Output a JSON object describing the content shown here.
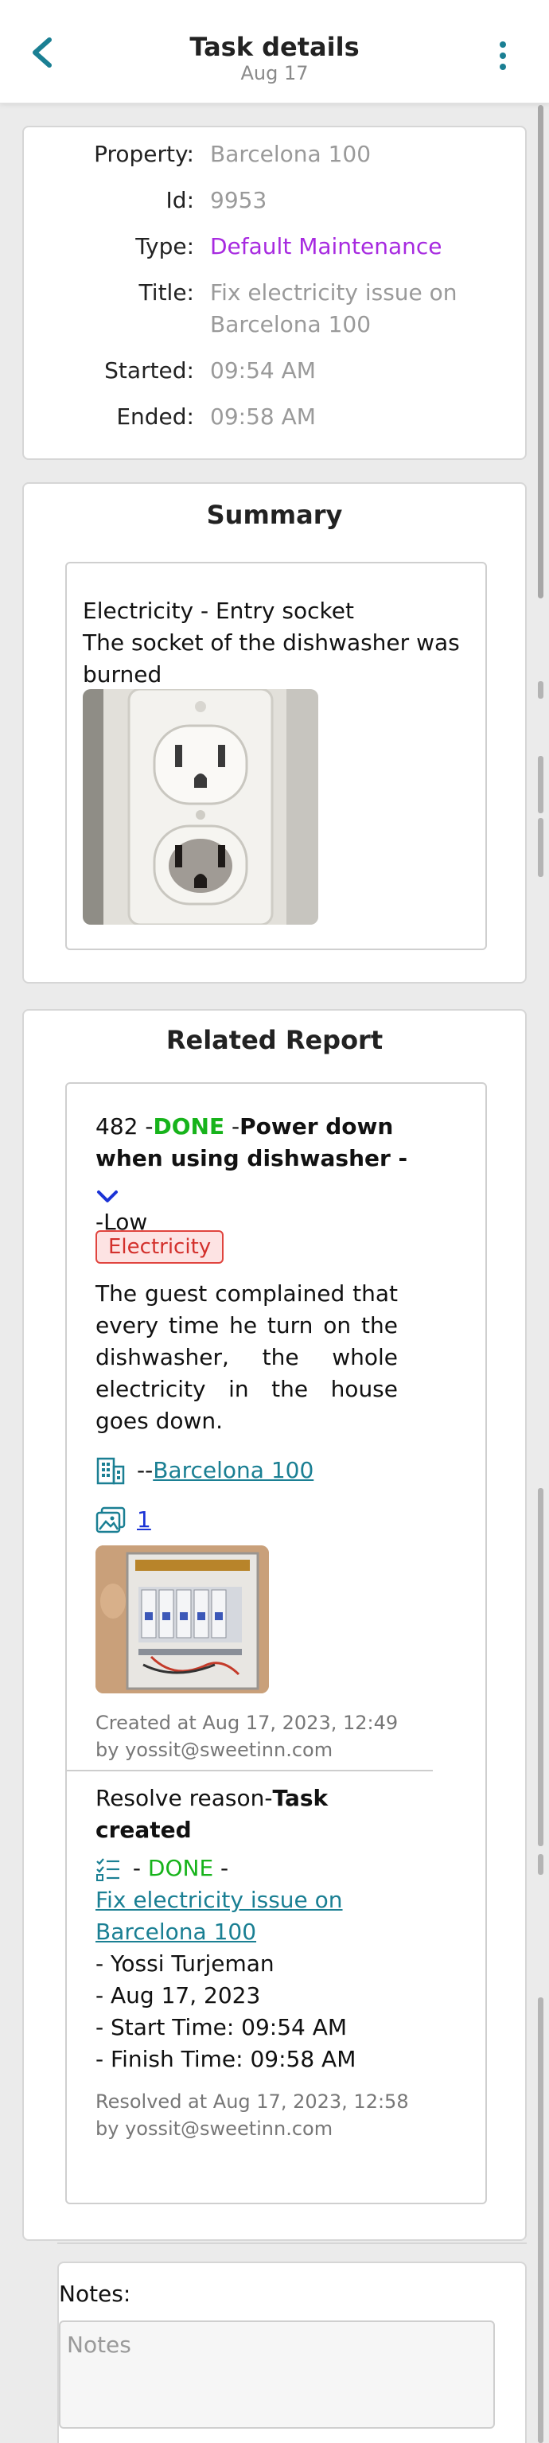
{
  "header": {
    "title": "Task details",
    "subtitle": "Aug 17"
  },
  "details": {
    "rows": [
      {
        "label": "Property:",
        "value": "Barcelona 100"
      },
      {
        "label": "Id:",
        "value": "9953"
      },
      {
        "label": "Type:",
        "value": "Default Maintenance"
      },
      {
        "label": "Title:",
        "value": "Fix electricity issue on Barcelona 100"
      },
      {
        "label": "Started:",
        "value": "09:54 AM"
      },
      {
        "label": "Ended:",
        "value": "09:58 AM"
      }
    ]
  },
  "summary": {
    "heading": "Summary",
    "line1": "Electricity - Entry socket",
    "line2": "The socket of the dishwasher was burned"
  },
  "report": {
    "heading": "Related Report",
    "id": "482",
    "sep1": " -",
    "status": "DONE",
    "sep2": " -",
    "title": "Power down when using dishwasher",
    "sep3": " -",
    "priority": "-Low",
    "tag": "Electricity",
    "description": "The guest complained that every time he turn on the dishwasher, the whole electricity in the house goes down.",
    "property_prefix": "-- ",
    "property_link": "Barcelona 100",
    "images_count": "1",
    "created": "Created at Aug 17, 2023, 12:49",
    "created_by": "by yossit@sweetinn.com",
    "resolve_label": "Resolve reason-",
    "resolve_reason": "Task created",
    "task_prefix": " - ",
    "task_status": "DONE",
    "task_suffix": " -",
    "task_link": "Fix electricity issue on Barcelona 100",
    "assignee": " - Yossi Turjeman",
    "date": " - Aug 17, 2023",
    "start_time": " - Start Time: 09:54 AM",
    "finish_time": " - Finish Time: 09:58 AM",
    "resolved": "Resolved at Aug 17, 2023, 12:58",
    "resolved_by": "by yossit@sweetinn.com"
  },
  "notes": {
    "label": "Notes:",
    "placeholder": "Notes"
  },
  "colors": {
    "accent": "#1a7f93",
    "done": "#17b31b",
    "type": "#a72ae0",
    "tag_border": "#e0443e"
  },
  "icons": {
    "back": "chevron-left-icon",
    "menu": "more-vertical-icon",
    "expand": "chevron-down-icon",
    "property": "building-icon",
    "images": "images-icon",
    "task": "checklist-icon"
  }
}
